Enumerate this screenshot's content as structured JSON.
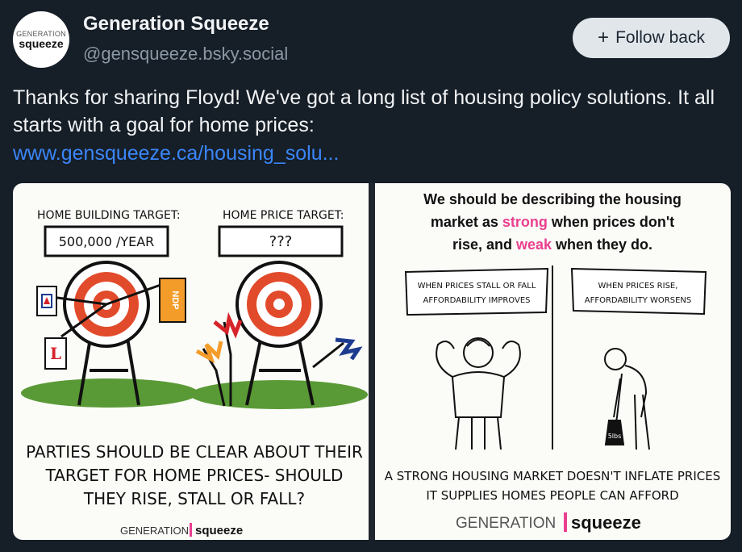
{
  "author": {
    "name": "Generation Squeeze",
    "handle": "@gensqueeze.bsky.social",
    "avatar_line1": "GENERATION",
    "avatar_line2": "squeeze"
  },
  "follow_button": {
    "icon": "plus-icon",
    "label": "Follow back"
  },
  "post": {
    "text": "Thanks for sharing Floyd! We've got a long list of housing policy solutions. It all starts with a goal for home prices:",
    "link": "www.gensqueeze.ca/housing_solu..."
  },
  "left_image": {
    "home_building_title": "HOME BUILDING TARGET:",
    "home_building_value": "500,000 /YEAR",
    "home_price_title": "HOME PRICE TARGET:",
    "home_price_value": "???",
    "caption_line1": "PARTIES SHOULD BE CLEAR ABOUT THEIR",
    "caption_line2": "TARGET FOR HOME PRICES- SHOULD",
    "caption_line3": "THEY RISE, STALL OR FALL?",
    "flag_ndp": "NDP",
    "flag_liberal": "L",
    "logo_left": "GENERATION",
    "logo_right": "squeeze"
  },
  "right_image": {
    "heading_line1": "We should be describing the housing",
    "heading_line2_pre": "market as ",
    "heading_strong": "strong",
    "heading_line2_post": " when prices don't",
    "heading_line3_pre": "rise, and ",
    "heading_weak": "weak",
    "heading_line3_post": " when they do.",
    "sign_left_line1": "WHEN PRICES STALL OR FALL",
    "sign_left_line2": "AFFORDABILITY IMPROVES",
    "sign_right_line1": "WHEN PRICES RISE,",
    "sign_right_line2": "AFFORDABILITY WORSENS",
    "weight_label": "5lbs",
    "caption_line1": "A STRONG HOUSING MARKET DOESN'T INFLATE PRICES",
    "caption_line2": "IT SUPPLIES HOMES PEOPLE CAN AFFORD",
    "logo_left": "GENERATION",
    "logo_right": "squeeze",
    "accent_color": "#ea3f8e"
  }
}
